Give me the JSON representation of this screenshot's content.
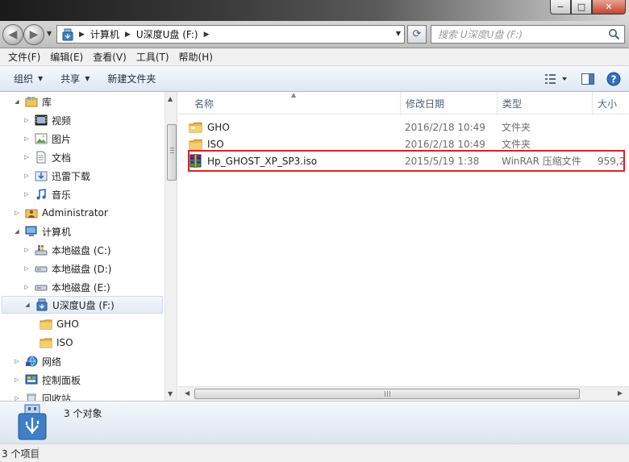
{
  "window": {
    "controls": {
      "minimize": "−",
      "maximize": "□",
      "close": "✕"
    }
  },
  "address": {
    "crumbs": [
      "计算机",
      "U深度U盘 (F:)"
    ],
    "search_placeholder": "搜索 U深度U盘 (F:)"
  },
  "menu": [
    "文件(F)",
    "编辑(E)",
    "查看(V)",
    "工具(T)",
    "帮助(H)"
  ],
  "toolbar": {
    "organize": "组织",
    "share": "共享",
    "new_folder": "新建文件夹"
  },
  "nav": {
    "items": [
      {
        "label": "库",
        "icon": "library-icon",
        "expanded": true
      },
      {
        "label": "视频",
        "icon": "video-library-icon"
      },
      {
        "label": "图片",
        "icon": "pictures-library-icon"
      },
      {
        "label": "文档",
        "icon": "documents-library-icon"
      },
      {
        "label": "迅雷下载",
        "icon": "download-library-icon"
      },
      {
        "label": "音乐",
        "icon": "music-library-icon"
      },
      {
        "label": "Administrator",
        "icon": "user-folder-icon"
      },
      {
        "label": "计算机",
        "icon": "computer-icon",
        "expanded": true
      },
      {
        "label": "本地磁盘 (C:)",
        "icon": "system-drive-icon"
      },
      {
        "label": "本地磁盘 (D:)",
        "icon": "drive-icon"
      },
      {
        "label": "本地磁盘 (E:)",
        "icon": "drive-icon"
      },
      {
        "label": "U深度U盘 (F:)",
        "icon": "usb-drive-icon",
        "expanded": true,
        "selected": true
      },
      {
        "label": "GHO",
        "icon": "folder-icon"
      },
      {
        "label": "ISO",
        "icon": "folder-icon"
      },
      {
        "label": "网络",
        "icon": "network-icon"
      },
      {
        "label": "控制面板",
        "icon": "control-panel-icon"
      },
      {
        "label": "回收站",
        "icon": "recycle-bin-icon"
      }
    ]
  },
  "list": {
    "columns": [
      "名称",
      "修改日期",
      "类型",
      "大小"
    ],
    "rows": [
      {
        "name": "GHO",
        "date": "2016/2/18 10:49",
        "type": "文件夹",
        "size": "",
        "icon": "folder-icon"
      },
      {
        "name": "ISO",
        "date": "2016/2/18 10:49",
        "type": "文件夹",
        "size": "",
        "icon": "folder-icon"
      },
      {
        "name": "Hp_GHOST_XP_SP3.iso",
        "date": "2015/5/19 1:38",
        "type": "WinRAR 压缩文件",
        "size": "959,2",
        "icon": "winrar-archive-icon",
        "highlighted": true
      }
    ]
  },
  "details": {
    "count": "3 个对象"
  },
  "status": {
    "items": "3 个项目"
  },
  "colors": {
    "highlight_box": "#d6232c",
    "folder": "#e8b84a",
    "accent": "#2f5e9c"
  }
}
